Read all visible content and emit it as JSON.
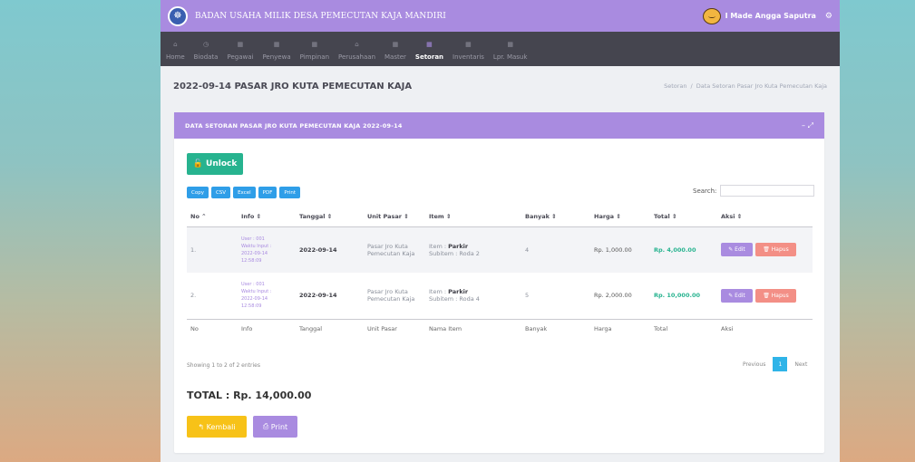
{
  "topbar": {
    "title": "BADAN USAHA MILIK DESA PEMECUTAN KAJA MANDIRI",
    "user": "I Made Angga Saputra"
  },
  "nav": [
    {
      "label": "Home",
      "icon": "home-icon"
    },
    {
      "label": "Biodata",
      "icon": "clock-icon"
    },
    {
      "label": "Pegawai",
      "icon": "grid-icon"
    },
    {
      "label": "Penyewa",
      "icon": "grid-icon"
    },
    {
      "label": "Pimpinan",
      "icon": "grid-icon"
    },
    {
      "label": "Perusahaan",
      "icon": "home-icon"
    },
    {
      "label": "Master",
      "icon": "grid-icon"
    },
    {
      "label": "Setoran",
      "icon": "grid-icon",
      "active": true
    },
    {
      "label": "Inventaris",
      "icon": "grid-icon"
    },
    {
      "label": "Lpr. Masuk",
      "icon": "grid-icon"
    }
  ],
  "page": {
    "title": "2022-09-14 PASAR JRO KUTA PEMECUTAN KAJA",
    "breadcrumb": [
      "Setoran",
      "Data Setoran Pasar Jro Kuta Pemecutan Kaja"
    ]
  },
  "card": {
    "title": "DATA SETORAN PASAR JRO KUTA PEMECUTAN KAJA 2022-09-14",
    "tools": "– ⤢"
  },
  "buttons": {
    "unlock": "Unlock",
    "exports": [
      "Copy",
      "CSV",
      "Excel",
      "PDF",
      "Print"
    ],
    "kembali": "Kembali",
    "print": "Print",
    "edit": "Edit",
    "hapus": "Hapus"
  },
  "search_label": "Search:",
  "table": {
    "headers": [
      "No",
      "Info",
      "Tanggal",
      "Unit Pasar",
      "Item",
      "Banyak",
      "Harga",
      "Total",
      "Aksi"
    ],
    "footer": [
      "No",
      "Info",
      "Tanggal",
      "Unit Pasar",
      "Nama Item",
      "Banyak",
      "Harga",
      "Total",
      "Aksi"
    ],
    "rows": [
      {
        "no": "1.",
        "info": [
          "User : 001",
          "Waktu Input :",
          "2022-09-14",
          "12:58:09"
        ],
        "tanggal": "2022-09-14",
        "unit": [
          "Pasar Jro Kuta",
          "Pemecutan Kaja"
        ],
        "item_label": "Item :",
        "item": "Parkir",
        "subitem": "Subitem : Roda 2",
        "banyak": "4",
        "harga": "Rp. 1,000.00",
        "total": "Rp. 4,000.00"
      },
      {
        "no": "2.",
        "info": [
          "User : 001",
          "Waktu Input :",
          "2022-09-14",
          "12:58:09"
        ],
        "tanggal": "2022-09-14",
        "unit": [
          "Pasar Jro Kuta",
          "Pemecutan Kaja"
        ],
        "item_label": "Item :",
        "item": "Parkir",
        "subitem": "Subitem : Roda 4",
        "banyak": "5",
        "harga": "Rp. 2,000.00",
        "total": "Rp. 10,000.00"
      }
    ]
  },
  "showing": "Showing 1 to 2 of 2 entries",
  "pagination": {
    "previous": "Previous",
    "current": "1",
    "next": "Next"
  },
  "total": "TOTAL : Rp. 14,000.00"
}
